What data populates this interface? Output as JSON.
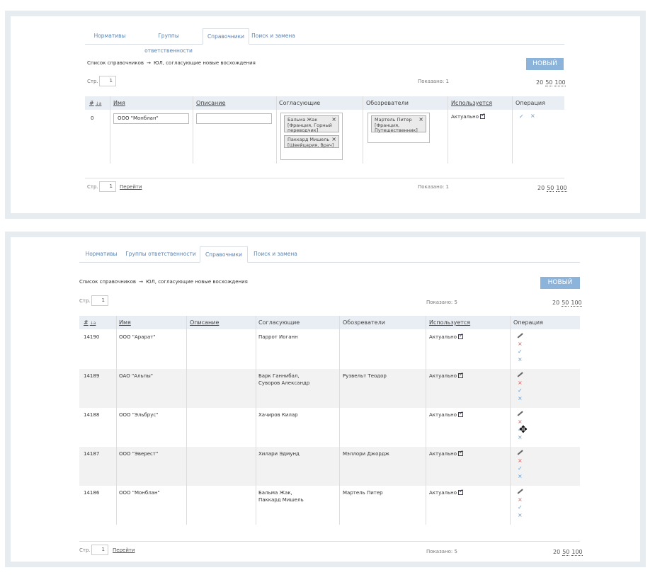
{
  "tabs": [
    "Нормативы",
    "Группы ответственности",
    "Справочники",
    "Поиск и замена"
  ],
  "active_tab": 2,
  "breadcrumb": {
    "root": "Список справочников",
    "arrow": "→",
    "current": "ЮЛ, согласующие новые восхождения"
  },
  "new_button": "НОВЫЙ",
  "pager": {
    "label": "Стр.",
    "page": "1",
    "goto": "Перейти",
    "sizes": [
      "20",
      "50",
      "100"
    ]
  },
  "columns": {
    "num": "#",
    "name": "Имя",
    "desc": "Описание",
    "approvers": "Согласующие",
    "reviewers": "Обозреватели",
    "used": "Используется",
    "op": "Операция"
  },
  "panel1": {
    "shown": "Показано: 1",
    "row": {
      "num": "0",
      "name": "ООО \"Монблан\"",
      "desc": "",
      "approvers": [
        "Бальма Жак [Франция, Горный переводчик]",
        "Паккард Мишель [Швейцария, Врач]"
      ],
      "reviewers": [
        "Мартель Питер [Франция, Путешественник]"
      ],
      "used": "Актуально"
    }
  },
  "panel2": {
    "shown": "Показано: 5",
    "rows": [
      {
        "num": "14190",
        "name": "ООО \"Арарат\"",
        "desc": "",
        "approvers": "Паррот Иоганн",
        "approvers2": "",
        "reviewers": "",
        "used": "Актуально"
      },
      {
        "num": "14189",
        "name": "ОАО \"Альпы\"",
        "desc": "",
        "approvers": "Барк Ганнибал,",
        "approvers2": "Суворов Александр",
        "reviewers": "Рузвельт Теодор",
        "used": "Актуально"
      },
      {
        "num": "14188",
        "name": "ООО \"Эльбрус\"",
        "desc": "",
        "approvers": "Хачиров Килар",
        "approvers2": "",
        "reviewers": "",
        "used": "Актуально"
      },
      {
        "num": "14187",
        "name": "ООО \"Эверест\"",
        "desc": "",
        "approvers": "Хилари Эдмунд",
        "approvers2": "",
        "reviewers": "Мэллори Джордж",
        "used": "Актуально"
      },
      {
        "num": "14186",
        "name": "ООО \"Монблан\"",
        "desc": "",
        "approvers": "Бальма Жак,",
        "approvers2": "Паккард Мишель",
        "reviewers": "Мартель Питер",
        "used": "Актуально"
      }
    ]
  },
  "icons": {
    "remove": "×",
    "ok": "✓",
    "cancel": "×",
    "delete": "×"
  },
  "colors": {
    "accent": "#8cb3d9",
    "link": "#5b82b0",
    "delete": "#e05a5a",
    "confirm": "#5b9bd5",
    "frame": "#e7ecf1"
  }
}
